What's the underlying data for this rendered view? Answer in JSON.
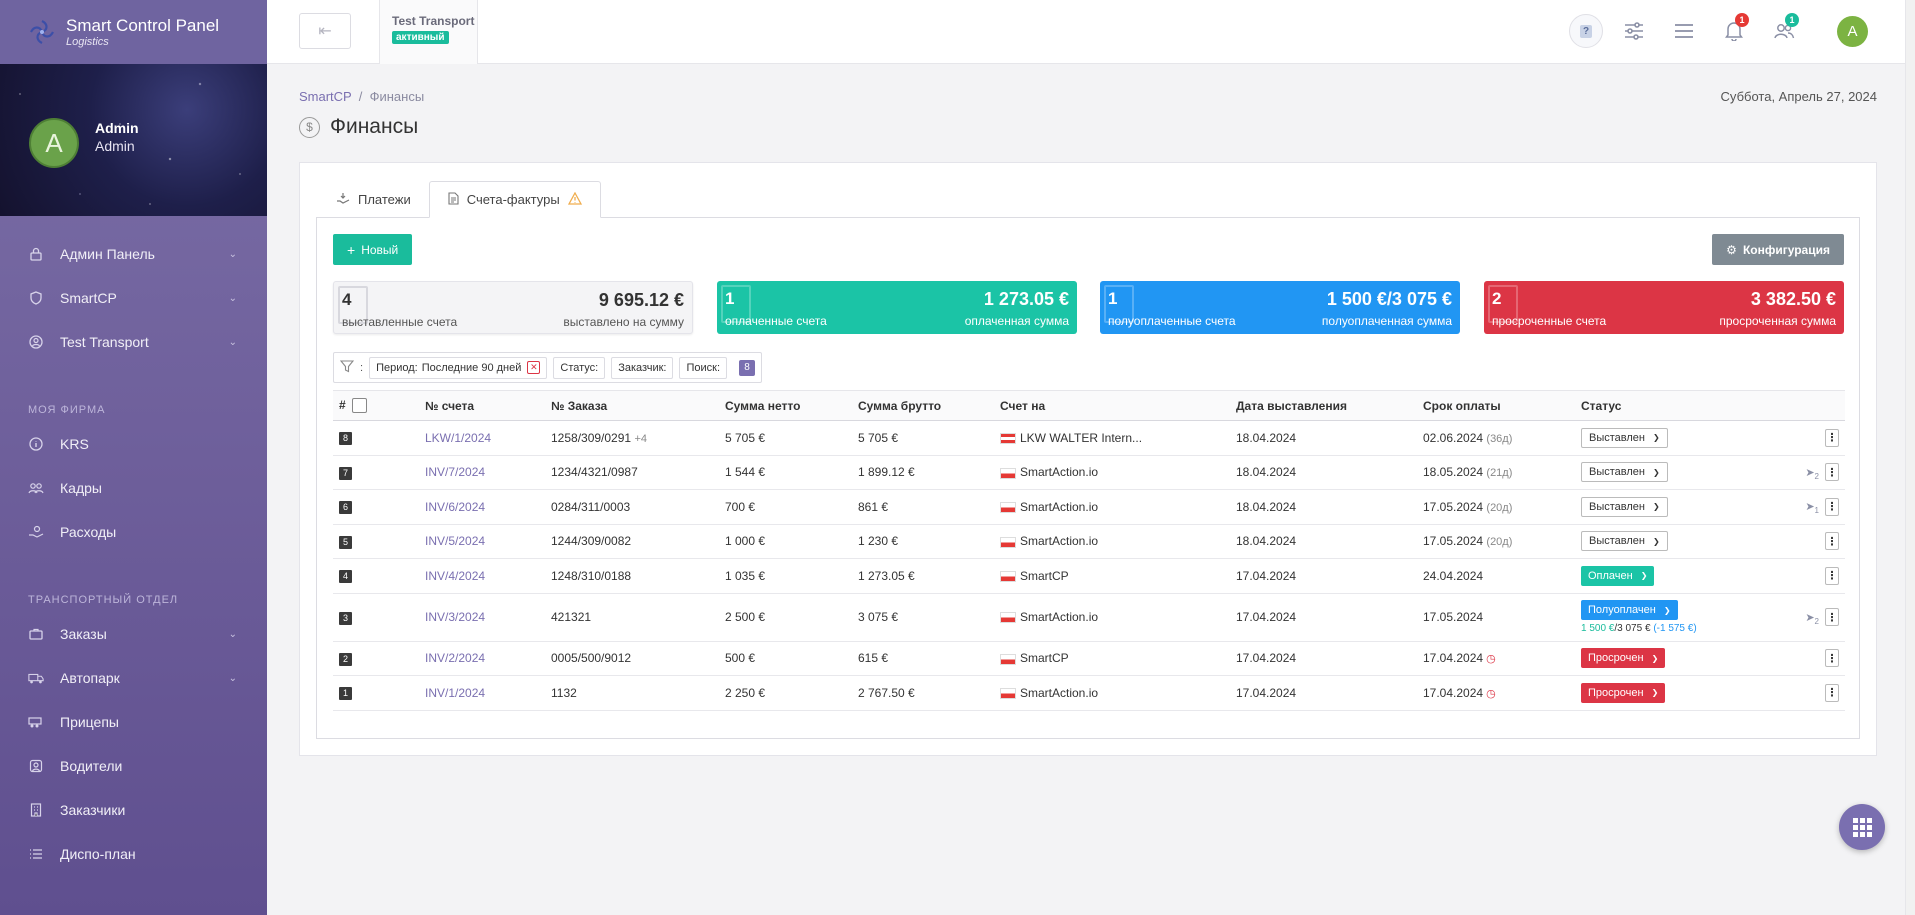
{
  "app": {
    "title": "Smart Control Panel",
    "subtitle": "Logistics"
  },
  "profile": {
    "initial": "A",
    "name": "Admin",
    "role": "Admin"
  },
  "sidebar": {
    "items_top": [
      {
        "label": "Админ Панель",
        "icon": "lock-icon",
        "chevron": true
      },
      {
        "label": "SmartCP",
        "icon": "shield-icon",
        "chevron": true
      },
      {
        "label": "Test Transport",
        "icon": "user-circle-icon",
        "chevron": true
      }
    ],
    "section1": "МОЯ ФИРМА",
    "items_firm": [
      {
        "label": "KRS",
        "icon": "info-icon"
      },
      {
        "label": "Кадры",
        "icon": "users-icon"
      },
      {
        "label": "Расходы",
        "icon": "hand-coins-icon"
      }
    ],
    "section2": "ТРАНСПОРТНЫЙ ОТДЕЛ",
    "items_transport": [
      {
        "label": "Заказы",
        "icon": "briefcase-icon",
        "chevron": true
      },
      {
        "label": "Автопарк",
        "icon": "truck-icon",
        "chevron": true
      },
      {
        "label": "Прицепы",
        "icon": "trailer-icon"
      },
      {
        "label": "Водители",
        "icon": "steering-wheel-icon"
      },
      {
        "label": "Заказчики",
        "icon": "building-icon"
      },
      {
        "label": "Диспо-план",
        "icon": "list-icon"
      }
    ]
  },
  "topbar": {
    "company_name": "Test Transport",
    "company_status": "активный",
    "help_label": "?",
    "notifications_count": "1",
    "users_count": "1",
    "user_initial": "A",
    "colors": {
      "notif_badge": "#e53935",
      "users_badge": "#1abc9c"
    }
  },
  "breadcrumb": {
    "root": "SmartCP",
    "current": "Финансы"
  },
  "date": "Суббота, Апрель 27, 2024",
  "page_title": "Финансы",
  "tabs": [
    {
      "label": "Платежи",
      "active": false
    },
    {
      "label": "Счета-фактуры",
      "active": true
    }
  ],
  "actions": {
    "new_label": "Новый",
    "config_label": "Конфигурация"
  },
  "stats": [
    {
      "count": "4",
      "count_label": "выставленные счета",
      "amount": "9 695.12 €",
      "amount_label": "выставлено на сумму"
    },
    {
      "count": "1",
      "count_label": "оплаченные счета",
      "amount": "1 273.05 €",
      "amount_label": "оплаченная сумма"
    },
    {
      "count": "1",
      "count_label": "полуоплаченные счета",
      "amount": "1 500 €/3 075 €",
      "amount_label": "полуоплаченная сумма"
    },
    {
      "count": "2",
      "count_label": "просроченные счета",
      "amount": "3 382.50 €",
      "amount_label": "просроченная сумма"
    }
  ],
  "filters": {
    "period_label": "Период:",
    "period_value": "Последние 90 дней",
    "status_label": "Статус:",
    "customer_label": "Заказчик:",
    "search_label": "Поиск:",
    "count": "8"
  },
  "table": {
    "headers": [
      "#",
      "№ счета",
      "№ Заказа",
      "Сумма нетто",
      "Сумма брутто",
      "Счет на",
      "Дата выставления",
      "Срок оплаты",
      "Статус"
    ],
    "rows": [
      {
        "no": "8",
        "invoice": "LKW/1/2024",
        "order": "1258/309/0291",
        "order_extra": "+4",
        "net": "5 705 €",
        "gross": "5 705 €",
        "flag": "at",
        "customer": "LKW WALTER Intern...",
        "issued": "18.04.2024",
        "due": "02.06.2024",
        "due_extra": "(36д)",
        "status": "Выставлен",
        "status_type": "issued",
        "reminder": ""
      },
      {
        "no": "7",
        "invoice": "INV/7/2024",
        "order": "1234/4321/0987",
        "order_extra": "",
        "net": "1 544 €",
        "gross": "1 899.12 €",
        "flag": "pl",
        "customer": "SmartAction.io",
        "issued": "18.04.2024",
        "due": "18.05.2024",
        "due_extra": "(21д)",
        "status": "Выставлен",
        "status_type": "issued",
        "reminder": "2"
      },
      {
        "no": "6",
        "invoice": "INV/6/2024",
        "order": "0284/311/0003",
        "order_extra": "",
        "net": "700 €",
        "gross": "861 €",
        "flag": "pl",
        "customer": "SmartAction.io",
        "issued": "18.04.2024",
        "due": "17.05.2024",
        "due_extra": "(20д)",
        "status": "Выставлен",
        "status_type": "issued",
        "reminder": "1"
      },
      {
        "no": "5",
        "invoice": "INV/5/2024",
        "order": "1244/309/0082",
        "order_extra": "",
        "net": "1 000 €",
        "gross": "1 230 €",
        "flag": "pl",
        "customer": "SmartAction.io",
        "issued": "18.04.2024",
        "due": "17.05.2024",
        "due_extra": "(20д)",
        "status": "Выставлен",
        "status_type": "issued",
        "reminder": ""
      },
      {
        "no": "4",
        "invoice": "INV/4/2024",
        "order": "1248/310/0188",
        "order_extra": "",
        "net": "1 035 €",
        "gross": "1 273.05 €",
        "flag": "pl",
        "customer": "SmartCP",
        "issued": "17.04.2024",
        "due": "24.04.2024",
        "due_extra": "",
        "status": "Оплачен",
        "status_type": "paid",
        "reminder": ""
      },
      {
        "no": "3",
        "invoice": "INV/3/2024",
        "order": "421321",
        "order_extra": "",
        "net": "2 500 €",
        "gross": "3 075 €",
        "flag": "pl",
        "customer": "SmartAction.io",
        "issued": "17.04.2024",
        "due": "17.05.2024",
        "due_extra": "",
        "status": "Полуоплачен",
        "status_type": "partial",
        "paid_part": "1 500 €",
        "total_part": "3 075 €",
        "rest_part": "(-1 575 €)",
        "reminder": "2"
      },
      {
        "no": "2",
        "invoice": "INV/2/2024",
        "order": "0005/500/9012",
        "order_extra": "",
        "net": "500 €",
        "gross": "615 €",
        "flag": "pl",
        "customer": "SmartCP",
        "issued": "17.04.2024",
        "due": "17.04.2024",
        "due_extra": "",
        "overdue": true,
        "status": "Просрочен",
        "status_type": "overdue",
        "reminder": ""
      },
      {
        "no": "1",
        "invoice": "INV/1/2024",
        "order": "1132",
        "order_extra": "",
        "net": "2 250 €",
        "gross": "2 767.50 €",
        "flag": "pl",
        "customer": "SmartAction.io",
        "issued": "17.04.2024",
        "due": "17.04.2024",
        "due_extra": "",
        "overdue": true,
        "status": "Просрочен",
        "status_type": "overdue",
        "reminder": ""
      }
    ]
  },
  "colors": {
    "accent": "#7a6fb0",
    "teal": "#1bc4a6",
    "blue": "#2196f3",
    "red": "#dc3545",
    "grey_button": "#7f8a93"
  }
}
